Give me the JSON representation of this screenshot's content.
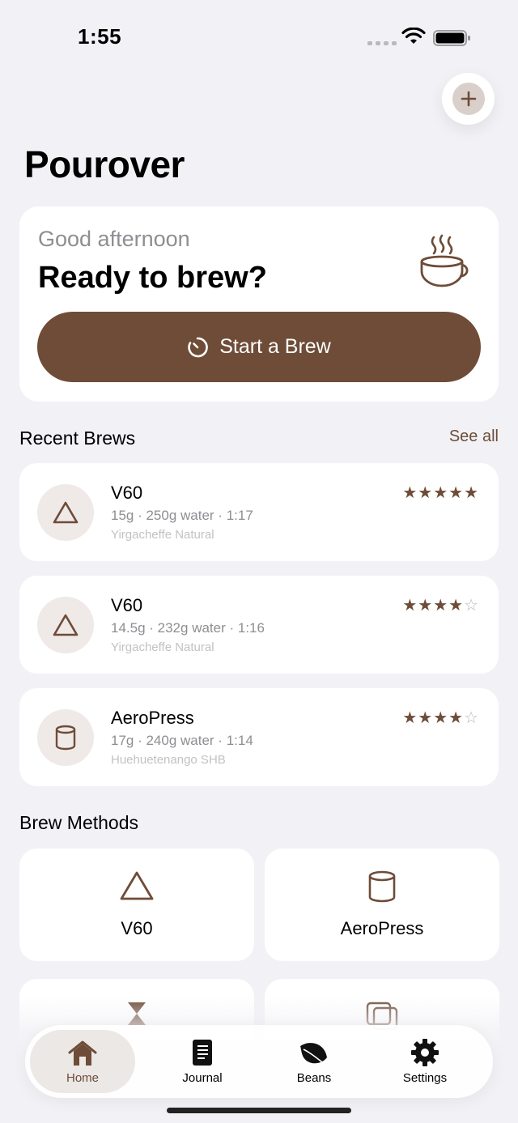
{
  "status": {
    "time": "1:55"
  },
  "colors": {
    "accent": "#6e4c38",
    "background": "#f2f2f6",
    "card": "#ffffff"
  },
  "header": {
    "title": "Pourover",
    "add_icon": "plus-icon"
  },
  "hero": {
    "greeting": "Good afternoon",
    "headline": "Ready to brew?",
    "button_label": "Start a Brew",
    "button_icon": "timer-icon",
    "decor_icon": "coffee-cup-icon"
  },
  "recent": {
    "title": "Recent Brews",
    "see_all": "See all",
    "items": [
      {
        "method": "V60",
        "stats": "15g · 250g water · 1:17",
        "bean": "Yirgacheffe Natural",
        "rating": 5,
        "icon": "triangle-icon"
      },
      {
        "method": "V60",
        "stats": "14.5g · 232g water · 1:16",
        "bean": "Yirgacheffe Natural",
        "rating": 4,
        "icon": "triangle-icon"
      },
      {
        "method": "AeroPress",
        "stats": "17g · 240g water · 1:14",
        "bean": "Huehuetenango SHB",
        "rating": 4,
        "icon": "cylinder-icon"
      }
    ]
  },
  "methods": {
    "title": "Brew Methods",
    "items": [
      {
        "label": "V60",
        "icon": "triangle-icon"
      },
      {
        "label": "AeroPress",
        "icon": "cylinder-icon"
      }
    ]
  },
  "tabs": [
    {
      "label": "Home",
      "icon": "house-icon",
      "active": true
    },
    {
      "label": "Journal",
      "icon": "journal-icon"
    },
    {
      "label": "Beans",
      "icon": "leaf-icon"
    },
    {
      "label": "Settings",
      "icon": "gear-icon"
    }
  ]
}
